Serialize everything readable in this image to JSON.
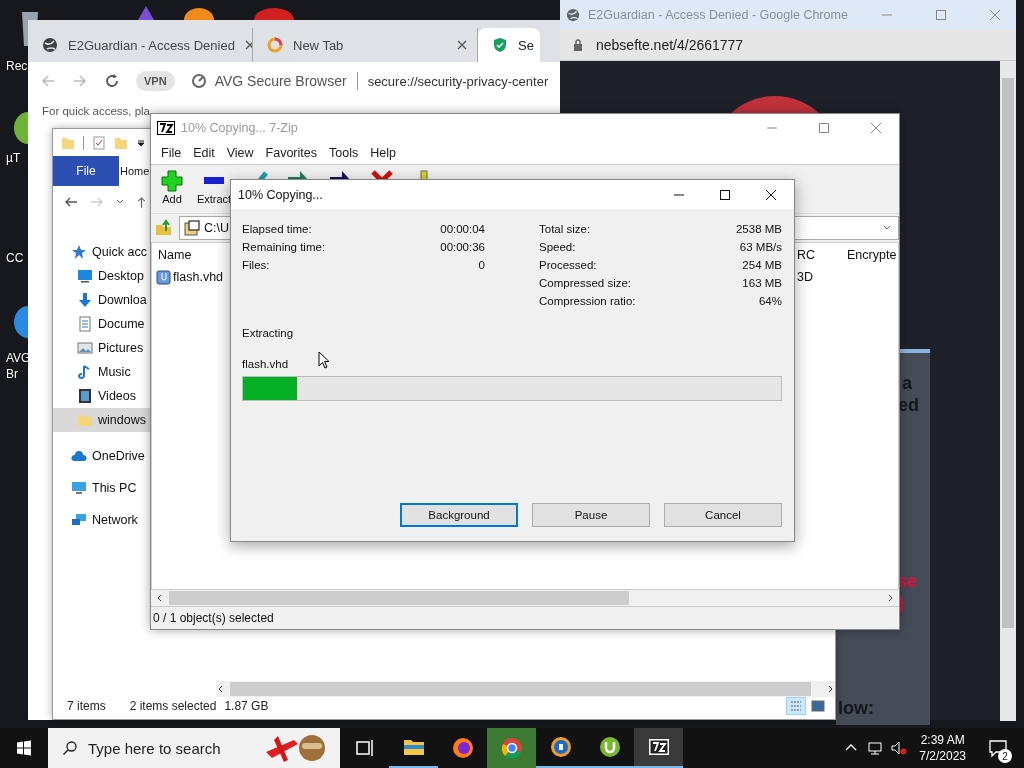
{
  "desktop": {
    "icons": [
      {
        "lines": [
          "Rec"
        ]
      },
      {
        "lines": [
          "µT"
        ]
      },
      {
        "lines": [
          "CC"
        ]
      },
      {
        "lines": [
          "AVG",
          "Br"
        ]
      }
    ]
  },
  "chrome_window": {
    "title": "E2Guardian - Access Denied - Google Chrome",
    "url": "nebsefte.net/4/2661777",
    "page_fragments": [
      {
        "text": "a",
        "kind": "heading"
      },
      {
        "text": "ed",
        "kind": "heading"
      },
      {
        "text": "se",
        "kind": "alert"
      },
      {
        "text": ")",
        "kind": "alert"
      },
      {
        "text": "low:",
        "kind": "heading"
      }
    ]
  },
  "browser_window": {
    "tabs": [
      {
        "label": "E2Guardian - Access Denied",
        "kind": "globe",
        "selected": false
      },
      {
        "label": "New Tab",
        "kind": "ring",
        "selected": false
      },
      {
        "label": "Se",
        "kind": "shield",
        "selected": true
      }
    ],
    "vpn_badge": "VPN",
    "site_label": "AVG Secure Browser",
    "address": "secure://security-privacy-center",
    "bookmarks_hint": "For quick access, pla"
  },
  "explorer": {
    "ribbon_tabs": [
      {
        "label": "File",
        "selected": true
      },
      {
        "label": "Home",
        "selected": false
      }
    ],
    "nav": [
      {
        "label": "Quick acc",
        "kind": "star",
        "selected": false,
        "children": [
          {
            "label": "Desktop",
            "kind": "desktop",
            "selected": false
          },
          {
            "label": "Downloa",
            "kind": "download",
            "selected": false
          },
          {
            "label": "Docume",
            "kind": "document",
            "selected": false
          },
          {
            "label": "Pictures",
            "kind": "pictures",
            "selected": false
          },
          {
            "label": "Music",
            "kind": "music",
            "selected": false
          },
          {
            "label": "Videos",
            "kind": "videos",
            "selected": false
          },
          {
            "label": "windows",
            "kind": "folder",
            "selected": true
          }
        ]
      },
      {
        "label": "OneDrive",
        "kind": "cloud",
        "selected": false
      },
      {
        "label": "This PC",
        "kind": "pc",
        "selected": false
      },
      {
        "label": "Network",
        "kind": "network",
        "selected": false
      }
    ],
    "item_count": "7 items",
    "selection": "2 items selected",
    "selection_size": "1.87 GB"
  },
  "sevenzip": {
    "title": "10% Copying... 7-Zip",
    "menu": [
      "File",
      "Edit",
      "View",
      "Favorites",
      "Tools",
      "Help"
    ],
    "toolbar": [
      {
        "label": "Add",
        "kind": "add"
      },
      {
        "label": "Extract",
        "kind": "extract"
      },
      {
        "kind": "test"
      },
      {
        "kind": "copy"
      },
      {
        "kind": "move"
      },
      {
        "kind": "delete"
      },
      {
        "kind": "info"
      }
    ],
    "path": "C:\\U",
    "columns": [
      "Name",
      "RC",
      "Encrypte"
    ],
    "rows": [
      {
        "name": "flash.vhd",
        "column_2": "3D"
      }
    ],
    "status": "0 / 1 object(s) selected"
  },
  "dialog": {
    "title": "10% Copying...",
    "stats_left": [
      {
        "label": "Elapsed time:",
        "value": "00:00:04"
      },
      {
        "label": "Remaining time:",
        "value": "00:00:36"
      },
      {
        "label": "Files:",
        "value": "0"
      }
    ],
    "stats_right": [
      {
        "label": "Total size:",
        "value": "2538 MB"
      },
      {
        "label": "Speed:",
        "value": "63 MB/s"
      },
      {
        "label": "Processed:",
        "value": "254 MB"
      },
      {
        "label": "Compressed size:",
        "value": "163 MB"
      },
      {
        "label": "Compression ratio:",
        "value": "64%"
      }
    ],
    "operation": "Extracting",
    "file": "flash.vhd",
    "progress": {
      "level": 0.1
    },
    "buttons": [
      {
        "label": "Background",
        "focused": true
      },
      {
        "label": "Pause",
        "focused": false
      },
      {
        "label": "Cancel",
        "focused": false
      }
    ]
  },
  "taskbar": {
    "search_placeholder": "Type here to search",
    "apps": [
      {
        "kind": "taskview",
        "running": false,
        "flashing": false,
        "selected": false
      },
      {
        "kind": "explorer",
        "running": true,
        "flashing": false,
        "selected": false
      },
      {
        "kind": "firefox",
        "running": false,
        "flashing": false,
        "selected": false
      },
      {
        "kind": "chrome",
        "running": false,
        "flashing": true,
        "selected": false
      },
      {
        "kind": "avg",
        "running": true,
        "flashing": false,
        "selected": false
      },
      {
        "kind": "utorrent",
        "running": true,
        "flashing": false,
        "selected": false
      },
      {
        "kind": "sevenzip",
        "running": true,
        "flashing": false,
        "selected": true
      }
    ],
    "time": "2:39 AM",
    "date": "7/2/2023",
    "notifications": "2"
  }
}
